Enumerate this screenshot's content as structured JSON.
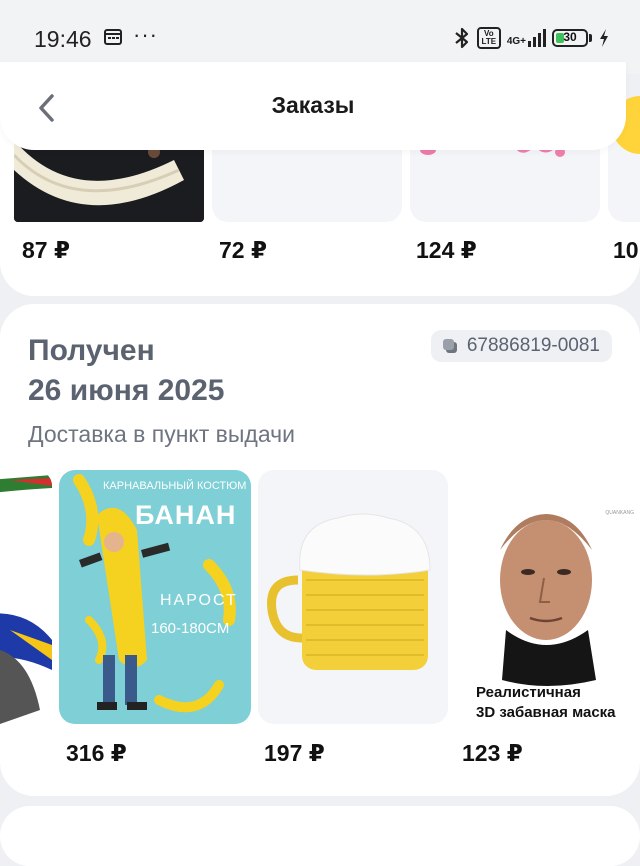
{
  "status_bar": {
    "time": "19:46",
    "dots": "···",
    "volte": "Vo LTE",
    "network": "4G+",
    "battery": "30",
    "battery_level": 0.3
  },
  "header": {
    "title": "Заказы"
  },
  "card1": {
    "prices": [
      "87 ₽",
      "72 ₽",
      "124 ₽",
      "10"
    ]
  },
  "card2": {
    "status": "Получен",
    "date": "26 июня 2025",
    "delivery": "Доставка в пункт выдачи",
    "order_number": "67886819-0081",
    "products": [
      {
        "price": "316 ₽",
        "caption_top": "КАРНАВАЛЬНЫЙ КОСТЮМ",
        "caption_main": "БАНАН",
        "caption_size": "НАРОСТ",
        "caption_height": "160-180CM"
      },
      {
        "price": "197 ₽"
      },
      {
        "price": "123 ₽",
        "brand": "QUANKANG",
        "caption_line1": "Реалистичная",
        "caption_line2": "3D забавная маска"
      }
    ]
  },
  "colors": {
    "background": "#eef0f3",
    "card": "#ffffff",
    "status_text": "#5b6270",
    "battery_green": "#3ec05a",
    "banana_bg": "#7ecfd6",
    "banana_yellow": "#f5d21f",
    "beer_yellow": "#f3cf3a"
  }
}
